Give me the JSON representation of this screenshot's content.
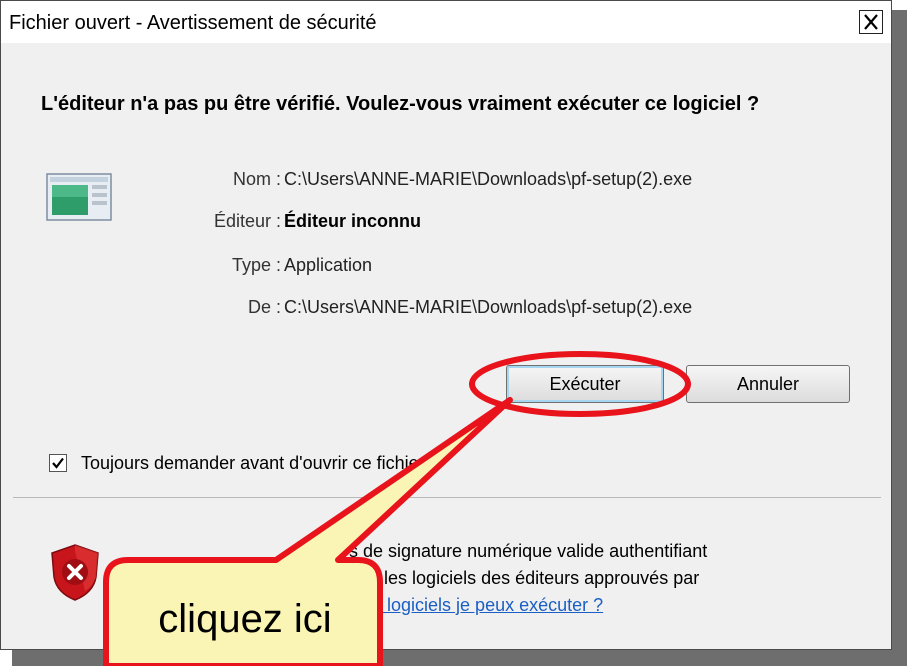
{
  "window": {
    "title": "Fichier ouvert - Avertissement de sécurité",
    "close_glyph": "✕",
    "close_icon": "close-icon"
  },
  "question": "L'éditeur n'a pas pu être vérifié. Voulez-vous vraiment exécuter ce logiciel ?",
  "file_icon": "application-icon",
  "details": {
    "name_label": "Nom :",
    "name_value": "C:\\Users\\ANNE-MARIE\\Downloads\\pf-setup(2).exe",
    "publisher_label": "Éditeur :",
    "publisher_value": "Éditeur inconnu",
    "type_label": "Type :",
    "type_value": "Application",
    "from_label": "De :",
    "from_value": "C:\\Users\\ANNE-MARIE\\Downloads\\pf-setup(2).exe"
  },
  "buttons": {
    "run": "Exécuter",
    "cancel": "Annuler"
  },
  "checkbox": {
    "checked": true,
    "label": "Toujours demander avant d'ouvrir ce fichier"
  },
  "warning": {
    "icon": "shield-error-icon",
    "line1": "s de signature numérique valide authentifiant",
    "line2": "que les logiciels des éditeurs approuvés par",
    "link": "uels logiciels je peux exécuter ?"
  },
  "annotation": {
    "callout_text": "cliquez ici",
    "highlight_color": "#e8131b",
    "callout_fill": "#fbf5b5"
  }
}
